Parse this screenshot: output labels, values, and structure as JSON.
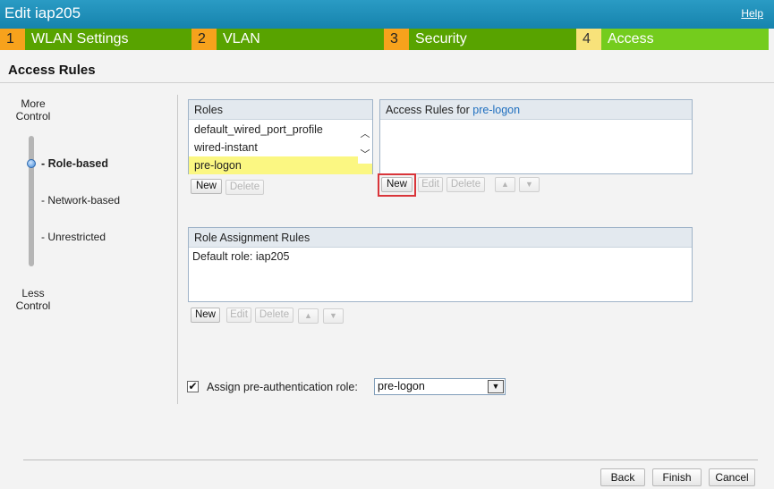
{
  "window": {
    "title": "Edit iap205",
    "help_label": "Help"
  },
  "steps": [
    {
      "num": "1",
      "label": "WLAN Settings"
    },
    {
      "num": "2",
      "label": "VLAN"
    },
    {
      "num": "3",
      "label": "Security"
    },
    {
      "num": "4",
      "label": "Access"
    }
  ],
  "section": {
    "title": "Access Rules"
  },
  "control_slider": {
    "top_label_1": "More",
    "top_label_2": "Control",
    "bottom_label_1": "Less",
    "bottom_label_2": "Control",
    "options": [
      "- Role-based",
      "- Network-based",
      "- Unrestricted"
    ],
    "selected": "- Role-based"
  },
  "roles": {
    "header": "Roles",
    "items": [
      "default_wired_port_profile",
      "wired-instant",
      "pre-logon"
    ],
    "selected": "pre-logon",
    "buttons": {
      "new": "New",
      "delete": "Delete"
    }
  },
  "access_rules": {
    "header_prefix": "Access Rules for ",
    "header_role": "pre-logon",
    "buttons": {
      "new": "New",
      "edit": "Edit",
      "delete": "Delete"
    }
  },
  "role_assignment": {
    "header": "Role Assignment Rules",
    "default_role_text": "Default role: iap205",
    "buttons": {
      "new": "New",
      "edit": "Edit",
      "delete": "Delete"
    }
  },
  "pre_auth": {
    "label": "Assign pre-authentication role:",
    "checked": true,
    "check_mark": "✔",
    "selected_role": "pre-logon"
  },
  "footer": {
    "back": "Back",
    "finish": "Finish",
    "cancel": "Cancel"
  },
  "colors": {
    "title_bar": "#1683ad",
    "step_number": "#f7a21c",
    "step_active_number": "#f8e27a",
    "step_label": "#58a300",
    "step_active_label": "#74cc1d",
    "selected_row": "#fbf782",
    "highlight_border": "#d9353a",
    "link_blue": "#1f6fbf"
  }
}
